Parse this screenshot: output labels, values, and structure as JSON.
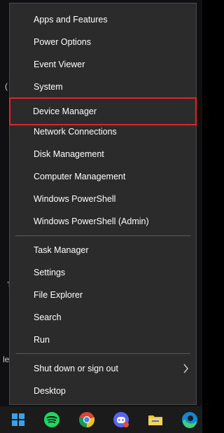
{
  "menu": {
    "items": [
      {
        "label": "Apps and Features"
      },
      {
        "label": "Power Options"
      },
      {
        "label": "Event Viewer"
      },
      {
        "label": "System"
      },
      {
        "label": "Device Manager"
      },
      {
        "label": "Network Connections"
      },
      {
        "label": "Disk Management"
      },
      {
        "label": "Computer Management"
      },
      {
        "label": "Windows PowerShell"
      },
      {
        "label": "Windows PowerShell (Admin)"
      },
      {
        "label": "Task Manager"
      },
      {
        "label": "Settings"
      },
      {
        "label": "File Explorer"
      },
      {
        "label": "Search"
      },
      {
        "label": "Run"
      },
      {
        "label": "Shut down or sign out"
      },
      {
        "label": "Desktop"
      }
    ],
    "highlighted_item": "Device Manager",
    "highlight_color": "#e0242f",
    "background_color": "#2b2b2b"
  },
  "background_fragments": [
    "(",
    "T",
    "le"
  ],
  "taskbar": {
    "icons": [
      {
        "name": "windows-start-icon"
      },
      {
        "name": "spotify-icon"
      },
      {
        "name": "chrome-icon"
      },
      {
        "name": "discord-icon"
      },
      {
        "name": "file-explorer-icon"
      },
      {
        "name": "edge-icon"
      }
    ]
  }
}
